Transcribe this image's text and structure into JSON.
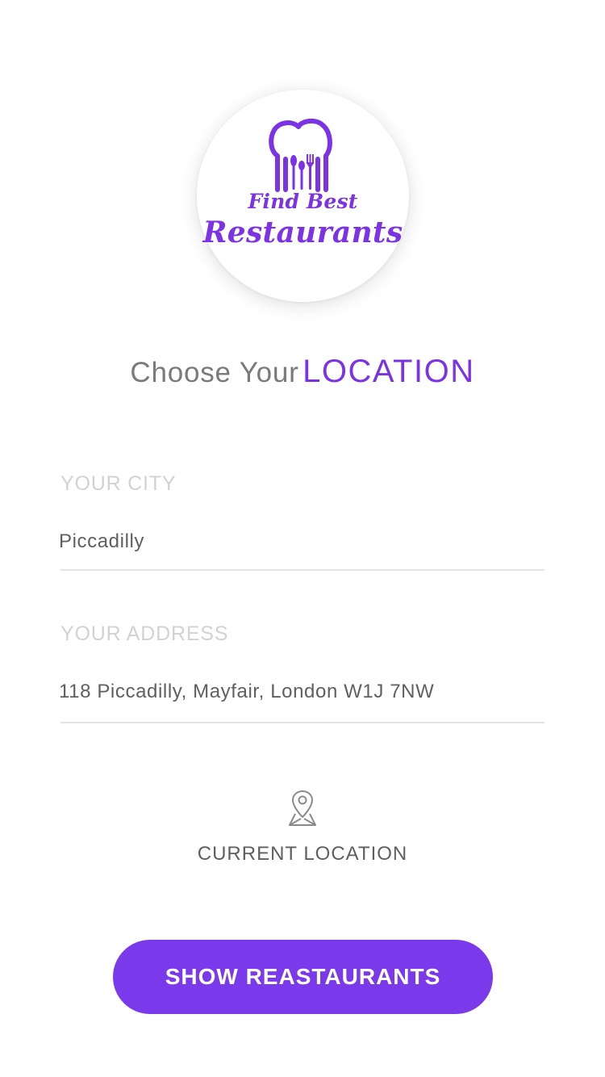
{
  "logo": {
    "icon": "chef-hat-cutlery-icon",
    "line1": "Find Best",
    "line2": "Restaurants",
    "color": "#7b33e5"
  },
  "heading": {
    "prefix": "Choose Your",
    "accent": "LOCATION"
  },
  "city": {
    "label": "YOUR CITY",
    "value": "Piccadilly"
  },
  "address": {
    "label": "YOUR ADDRESS",
    "value": "118 Piccadilly, Mayfair, London W1J 7NW"
  },
  "current_location": {
    "icon": "map-pin-icon",
    "label": "CURRENT LOCATION"
  },
  "button": {
    "label": "SHOW REASTAURANTS",
    "color": "#7b39ec"
  }
}
